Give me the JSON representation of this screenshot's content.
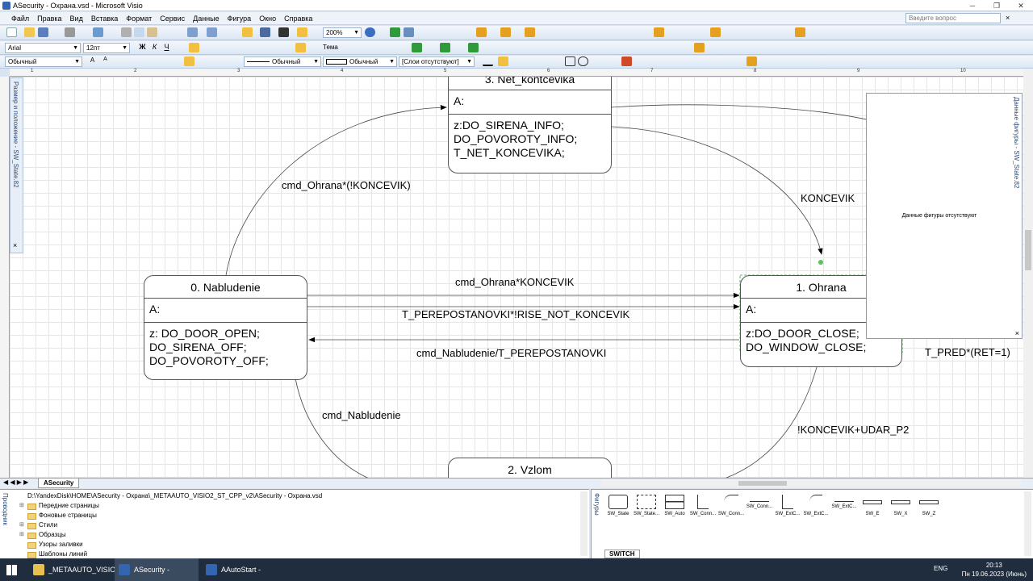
{
  "window": {
    "title": "ASecurity - Охрана.vsd - Microsoft Visio"
  },
  "menu": [
    "Файл",
    "Правка",
    "Вид",
    "Вставка",
    "Формат",
    "Сервис",
    "Данные",
    "Фигура",
    "Окно",
    "Справка"
  ],
  "ask_placeholder": "Введите вопрос",
  "toolbar": {
    "zoom": "200%",
    "font": "Arial",
    "font_size": "12пт",
    "style": "Обычный",
    "line_style": "Обычный",
    "fill_style": "Обычный",
    "layer": "[Слои отсутствуют]",
    "theme": "Тема"
  },
  "left_pane_title": "Размер и положение - SW_State.82",
  "data_panel": {
    "title": "Данные фигуры - SW_State.82",
    "message": "Данные фигуры отсутствуют"
  },
  "states": {
    "s3": {
      "title": "3. Net_kontcevika",
      "entry": "A:",
      "body": [
        "z:DO_SIRENA_INFO;",
        "DO_POVOROTY_INFO;",
        "T_NET_KONCEVIKA;"
      ]
    },
    "s0": {
      "title": "0. Nabludenie",
      "entry": "A:",
      "body": [
        "z: DO_DOOR_OPEN;",
        "DO_SIRENA_OFF;",
        "DO_POVOROTY_OFF;"
      ]
    },
    "s1": {
      "title": "1. Ohrana",
      "entry": "A:",
      "body": [
        "z:DO_DOOR_CLOSE;",
        "DO_WINDOW_CLOSE;"
      ]
    },
    "s2": {
      "title": "2. Vzlom"
    }
  },
  "transitions": {
    "t1": "cmd_Ohrana*(!KONCEVIK)",
    "t2": "KONCEVIK",
    "t3": "cmd_Ohrana*KONCEVIK",
    "t4": "T_PEREPOSTANOVKI*!RISE_NOT_KONCEVIK",
    "t5": "cmd_Nabludenie/T_PEREPOSTANOVKI",
    "t6": "cmd_Nabludenie",
    "t7": "!KONCEVIK+UDAR_P2",
    "t8": "T_PRED*(RET=1)"
  },
  "ruler_numbers": [
    "1",
    "2",
    "3",
    "4",
    "5",
    "6",
    "7",
    "8",
    "9",
    "10"
  ],
  "page_tab": "ASecurity",
  "explorer": {
    "title": "Проводник",
    "path": "D:\\YandexDisk\\HOME\\ASecurity - Охрана\\_METAAUTO_VISIO2_ST_CPP_v2\\ASecurity - Охрана.vsd",
    "items": [
      "Передние страницы",
      "Фоновые страницы",
      "Стили",
      "Образцы",
      "Узоры заливки",
      "Шаблоны линий"
    ]
  },
  "shapes_panel": {
    "title": "Фигуры",
    "items": [
      "SW_State",
      "SW_State...",
      "SW_Auto",
      "SW_Conn...",
      "SW_Conn...",
      "SW_Conn...",
      "SW_ExtC...",
      "SW_ExtC...",
      "SW_ExtC...",
      "SW_E",
      "SW_X",
      "SW_Z"
    ],
    "tab": "SWITCH"
  },
  "taskbar": {
    "tasks": [
      "_METAAUTO_VISIO...",
      "ASecurity - Охрана...",
      "AAutoStart - Автоз..."
    ],
    "lang": "ENG",
    "time": "20:13",
    "date": "Пн 19.06.2023 (Июнь)"
  }
}
